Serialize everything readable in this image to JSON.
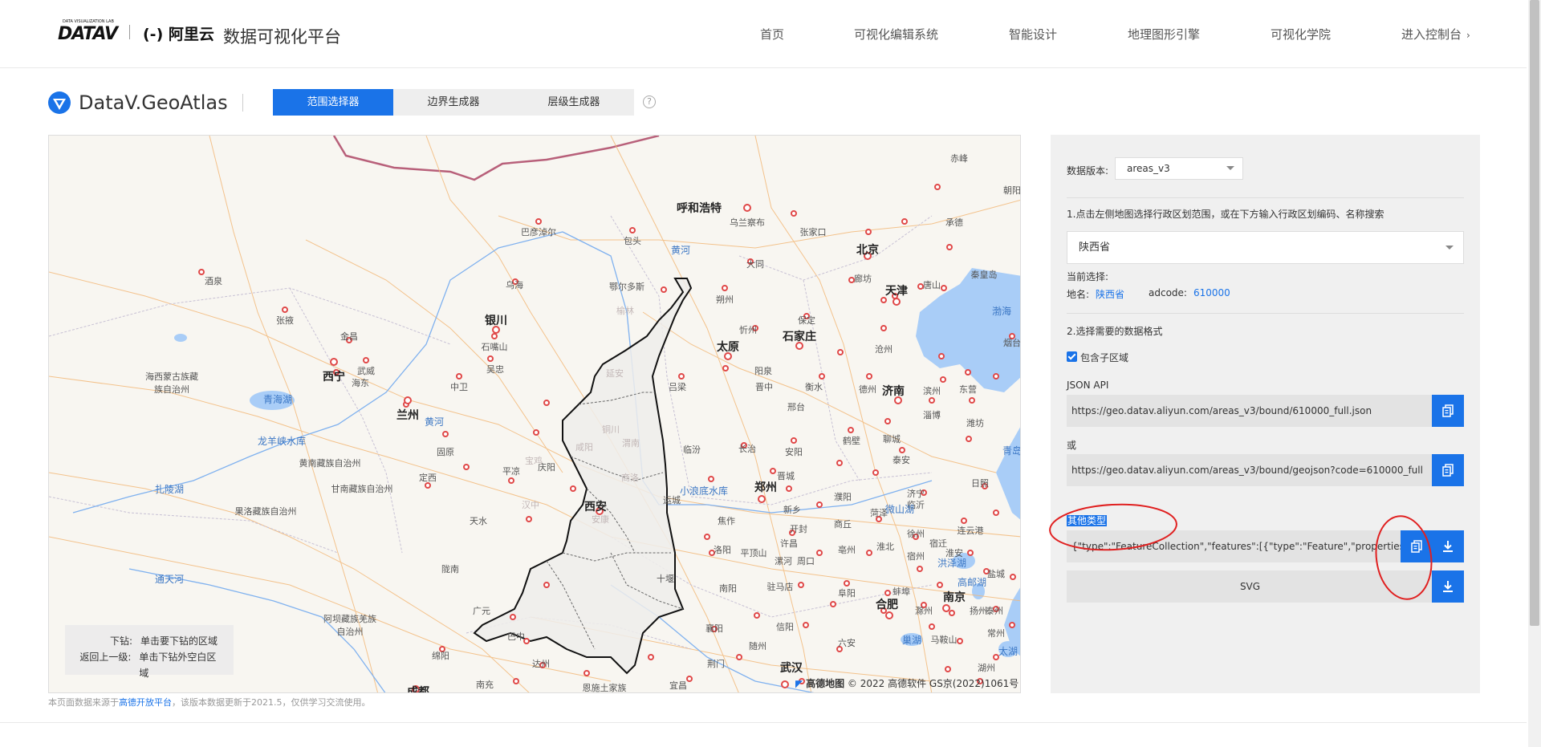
{
  "header": {
    "logo_datav": "DATAV",
    "logo_datav_sub": "DATA VISUALIZATION LAB",
    "logo_aliyun": "(-) 阿里云",
    "platform_title": "数据可视化平台",
    "nav": [
      "首页",
      "可视化编辑系统",
      "智能设计",
      "地理图形引擎",
      "可视化学院",
      "进入控制台"
    ]
  },
  "tool": {
    "brand": "DataV.GeoAtlas",
    "tabs": [
      "范围选择器",
      "边界生成器",
      "层级生成器"
    ],
    "active_tab": 0,
    "help": "?"
  },
  "map": {
    "hint_drill_key": "下钻:",
    "hint_drill_val": "单击要下钻的区域",
    "hint_back_key": "返回上一级:",
    "hint_back_val": "单击下钻外空白区域",
    "attribution_brand": "高德地图",
    "attribution_text": "© 2022 高德软件 GS京(2022)1061号",
    "cities_major": [
      "呼和浩特",
      "北京",
      "天津",
      "银川",
      "太原",
      "石家庄",
      "济南",
      "西宁",
      "兰州",
      "郑州",
      "西安",
      "合肥",
      "南京",
      "武汉",
      "成都"
    ],
    "cities_minor": [
      "赤峰",
      "承德",
      "朝阳",
      "巴彦淖尔",
      "包头",
      "乌兰察布",
      "张家口",
      "大同",
      "廊坊",
      "唐山",
      "秦皇岛",
      "鄂尔多斯",
      "乌海",
      "朔州",
      "忻州",
      "保定",
      "沧州",
      "酒泉",
      "张掖",
      "金昌",
      "武威",
      "石嘴山",
      "吴忠",
      "中卫",
      "吕梁",
      "阳泉",
      "晋中",
      "衡水",
      "邢台",
      "德州",
      "滨州",
      "东营",
      "潍坊",
      "淄博",
      "烟台",
      "海东",
      "固原",
      "庆阳",
      "平凉",
      "临汾",
      "长治",
      "晋城",
      "安阳",
      "鹤壁",
      "聊城",
      "泰安",
      "日照",
      "定西",
      "天水",
      "运城",
      "焦作",
      "新乡",
      "濮阳",
      "菏泽",
      "济宁",
      "临沂",
      "连云港",
      "陇南",
      "十堰",
      "洛阳",
      "开封",
      "许昌",
      "商丘",
      "徐州",
      "宿迁",
      "淮安",
      "盐城",
      "平顶山",
      "漯河",
      "周口",
      "亳州",
      "淮北",
      "宿州",
      "南阳",
      "驻马店",
      "阜阳",
      "蚌埠",
      "滁州",
      "扬州",
      "泰州",
      "广元",
      "巴中",
      "襄阳",
      "随州",
      "信阳",
      "六安",
      "马鞍山",
      "常州",
      "绵阳",
      "达州",
      "荆门",
      "宜昌",
      "南充",
      "恩施土家族",
      "湖州",
      "海东"
    ],
    "cities_dim": [
      "榆林",
      "延安",
      "铜川",
      "渭南",
      "宝鸡",
      "咸阳",
      "商洛",
      "汉中",
      "安康"
    ],
    "regions": [
      "海西蒙古族藏族自治州",
      "黄南藏族自治州",
      "甘南藏族自治州",
      "果洛藏族自治州",
      "阿坝藏族羌族自治州"
    ],
    "waters": [
      "青海湖",
      "龙羊峡水库",
      "黄河",
      "扎陵湖",
      "通天河",
      "小浪底水库",
      "微山湖",
      "渤海",
      "洪泽湖",
      "高邮湖",
      "巢湖",
      "太湖",
      "青岛"
    ]
  },
  "footnote": {
    "before": "本页面数据来源于",
    "link": "高德开放平台",
    "after": "，该版本数据更新于2021.5，仅供学习交流使用。"
  },
  "panel": {
    "version_label": "数据版本:",
    "version_value": "areas_v3",
    "step1": "1.点击左侧地图选择行政区划范围，或在下方输入行政区划编码、名称搜索",
    "region_value": "陕西省",
    "current_label": "当前选择:",
    "name_label": "地名:",
    "name_value": "陕西省",
    "adcode_label": "adcode:",
    "adcode_value": "610000",
    "step2": "2.选择需要的数据格式",
    "include_children": "包含子区域",
    "json_api_label": "JSON API",
    "json_api_url": "https://geo.datav.aliyun.com/areas_v3/bound/610000_full.json",
    "or_label": "或",
    "geojson_url": "https://geo.datav.aliyun.com/areas_v3/bound/geojson?code=610000_full",
    "other_label": "其他类型",
    "other_value": "{\"type\":\"FeatureCollection\",\"features\":[{\"type\":\"Feature\",\"properties\":{\"",
    "svg_label": "SVG"
  },
  "colors": {
    "accent": "#1a73e8",
    "annotation": "#e02020"
  }
}
